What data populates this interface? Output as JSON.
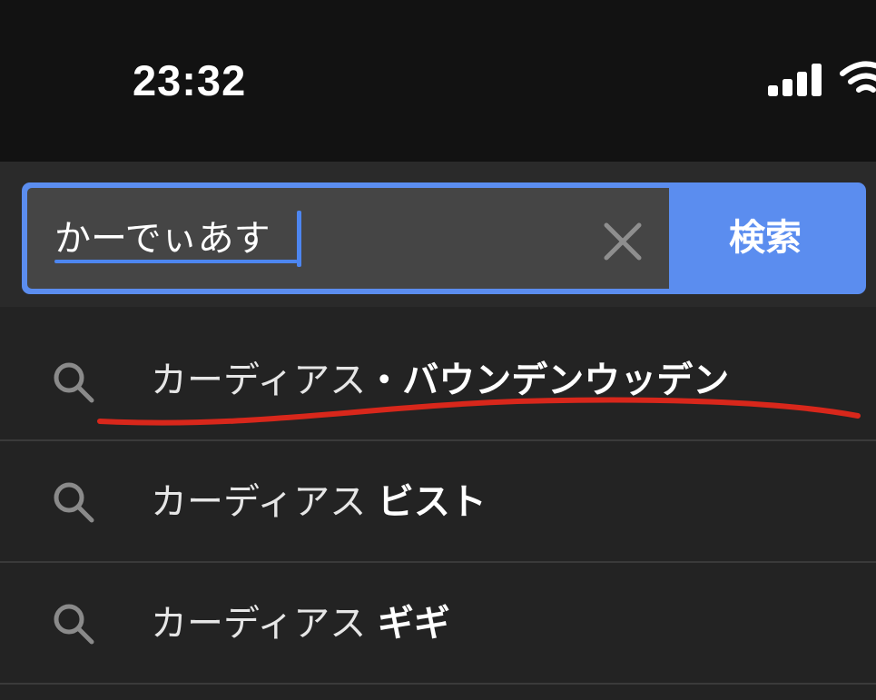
{
  "status_bar": {
    "time": "23:32",
    "signal_icon": "cellular-signal-icon",
    "wifi_icon": "wifi-icon"
  },
  "search": {
    "value": "かーでぃあす",
    "clear_icon": "clear-x-icon",
    "button_label": "検索",
    "accent_color": "#5b8def"
  },
  "suggestions": [
    {
      "prefix": "カーディアス",
      "suffix": "・バウンデンウッデン",
      "icon": "search-icon"
    },
    {
      "prefix": "カーディアス",
      "suffix": "ビスト",
      "icon": "search-icon"
    },
    {
      "prefix": "カーディアス",
      "suffix": "ギギ",
      "icon": "search-icon"
    }
  ],
  "annotation": {
    "color": "#d8271b",
    "target": "suggestion-1"
  }
}
